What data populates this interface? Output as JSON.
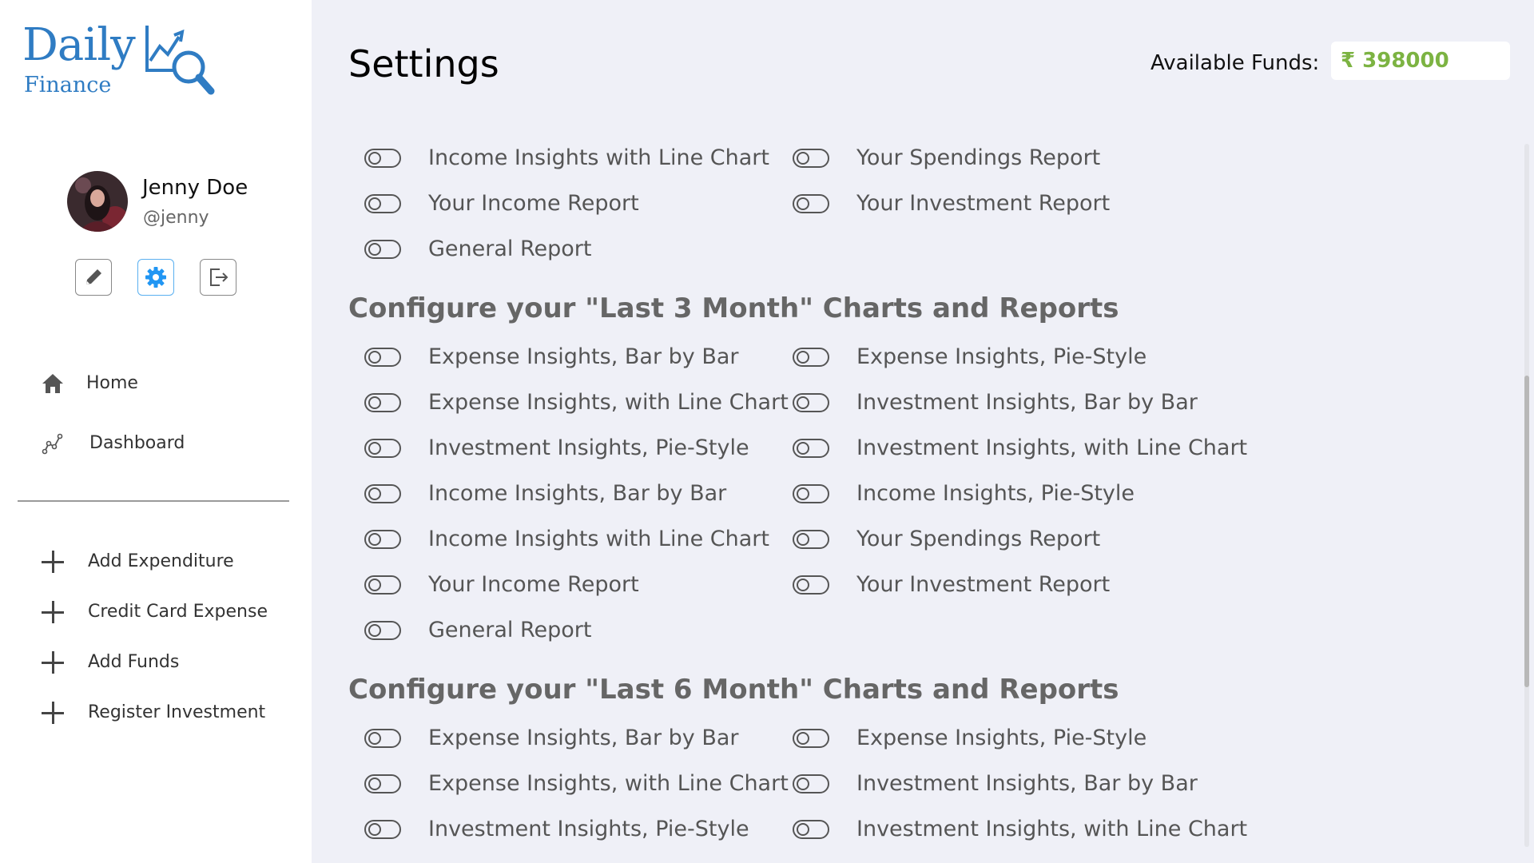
{
  "app": {
    "logo_text": "Daily",
    "logo_subtext": "Finance"
  },
  "user": {
    "name": "Jenny Doe",
    "handle": "@jenny"
  },
  "sidebar": {
    "nav": [
      {
        "label": "Home",
        "icon": "home-icon"
      },
      {
        "label": "Dashboard",
        "icon": "chart-nodes-icon"
      }
    ],
    "actions": [
      {
        "label": "Add Expenditure",
        "icon": "plus-icon"
      },
      {
        "label": "Credit Card Expense",
        "icon": "plus-icon"
      },
      {
        "label": "Add Funds",
        "icon": "plus-icon"
      },
      {
        "label": "Register Investment",
        "icon": "plus-icon"
      }
    ],
    "profile_buttons": [
      {
        "icon": "edit-icon"
      },
      {
        "icon": "gear-icon",
        "active": true
      },
      {
        "icon": "logout-icon"
      }
    ]
  },
  "header": {
    "title": "Settings",
    "funds_label": "Available Funds:",
    "funds_value": "₹ 398000",
    "funds_color": "#7cb342"
  },
  "sections": [
    {
      "title": "",
      "options": [
        {
          "label": "Income Insights with Line Chart",
          "enabled": false
        },
        {
          "label": "Your Spendings Report",
          "enabled": false
        },
        {
          "label": "Your Income Report",
          "enabled": false
        },
        {
          "label": "Your Investment Report",
          "enabled": false
        },
        {
          "label": "General Report",
          "enabled": false
        }
      ]
    },
    {
      "title": "Configure your \"Last 3 Month\" Charts and Reports",
      "options": [
        {
          "label": "Expense Insights, Bar by Bar",
          "enabled": false
        },
        {
          "label": "Expense Insights, Pie-Style",
          "enabled": false
        },
        {
          "label": "Expense Insights, with Line Chart",
          "enabled": false
        },
        {
          "label": "Investment Insights, Bar by Bar",
          "enabled": false
        },
        {
          "label": "Investment Insights, Pie-Style",
          "enabled": false
        },
        {
          "label": "Investment Insights, with Line Chart",
          "enabled": false
        },
        {
          "label": "Income Insights, Bar by Bar",
          "enabled": false
        },
        {
          "label": "Income Insights, Pie-Style",
          "enabled": false
        },
        {
          "label": "Income Insights with Line Chart",
          "enabled": false
        },
        {
          "label": "Your Spendings Report",
          "enabled": false
        },
        {
          "label": "Your Income Report",
          "enabled": false
        },
        {
          "label": "Your Investment Report",
          "enabled": false
        },
        {
          "label": "General Report",
          "enabled": false
        }
      ]
    },
    {
      "title": "Configure your \"Last 6 Month\" Charts and Reports",
      "options": [
        {
          "label": "Expense Insights, Bar by Bar",
          "enabled": false
        },
        {
          "label": "Expense Insights, Pie-Style",
          "enabled": false
        },
        {
          "label": "Expense Insights, with Line Chart",
          "enabled": false
        },
        {
          "label": "Investment Insights, Bar by Bar",
          "enabled": false
        },
        {
          "label": "Investment Insights, Pie-Style",
          "enabled": false
        },
        {
          "label": "Investment Insights, with Line Chart",
          "enabled": false
        }
      ]
    }
  ]
}
